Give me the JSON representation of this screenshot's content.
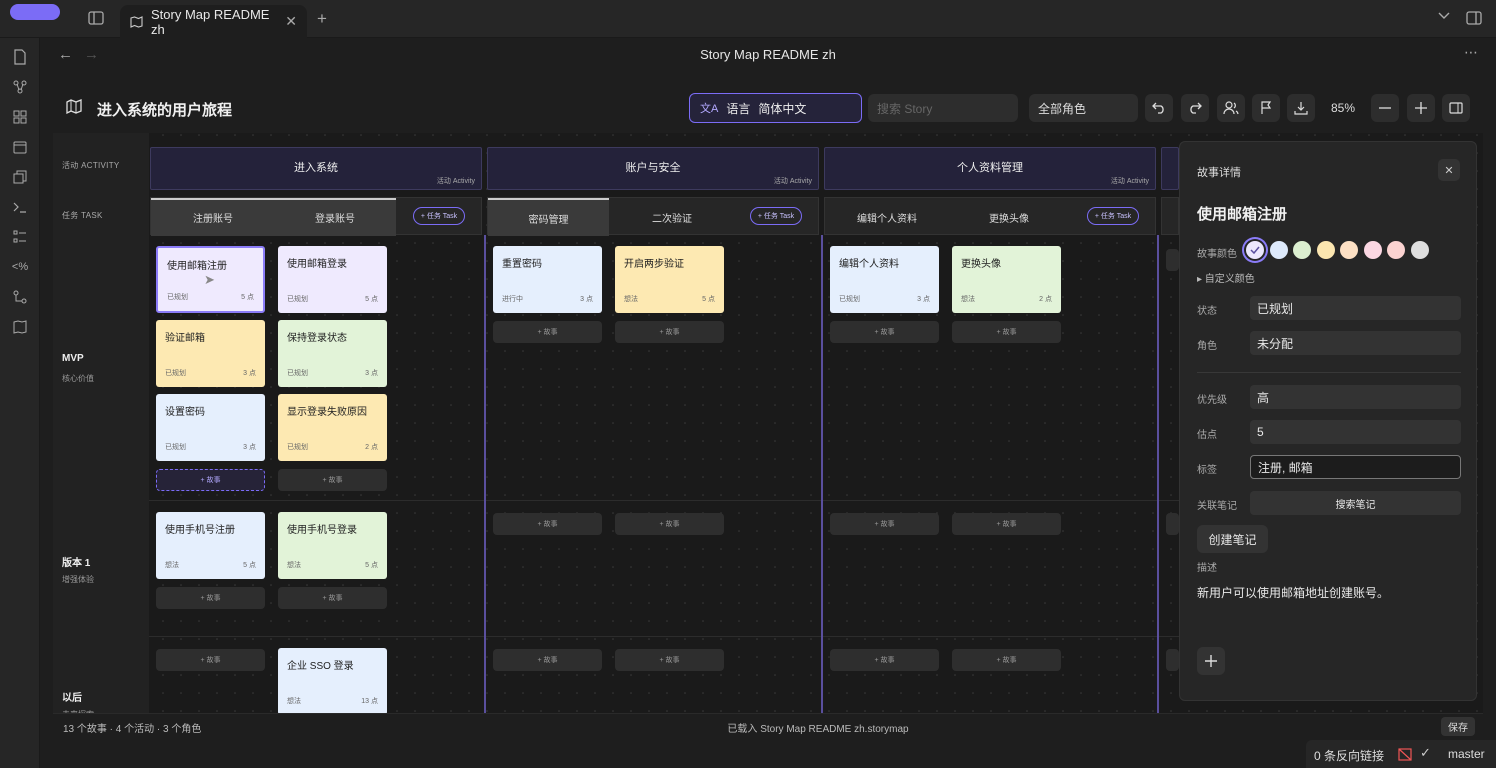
{
  "tab": {
    "title": "Story Map README zh"
  },
  "nav": {
    "title": "Story Map README zh"
  },
  "map": {
    "title": "进入系统的用户旅程"
  },
  "toolbar": {
    "lang_label": "语言",
    "lang_value": "简体中文",
    "search_placeholder": "搜索 Story",
    "roles": "全部角色",
    "zoom": "85%"
  },
  "rows": {
    "activity": "活动 ACTIVITY",
    "task": "任务 TASK"
  },
  "releases": [
    {
      "name": "MVP",
      "sub": "核心价值"
    },
    {
      "name": "版本 1",
      "sub": "增强体验"
    },
    {
      "name": "以后",
      "sub": "未来探索"
    }
  ],
  "activities": [
    {
      "title": "进入系统",
      "sub": "活动 Activity"
    },
    {
      "title": "账户与安全",
      "sub": "活动 Activity"
    },
    {
      "title": "个人资料管理",
      "sub": "活动 Activity"
    }
  ],
  "tasks": [
    "注册账号",
    "登录账号",
    "密码管理",
    "二次验证",
    "编辑个人资料",
    "更换头像"
  ],
  "add_task": "+ 任务 Task",
  "add_story": "+ 故事",
  "cards": [
    {
      "title": "使用邮箱注册",
      "status": "已规划",
      "points": "5 点",
      "color": "#efeafe"
    },
    {
      "title": "验证邮箱",
      "status": "已规划",
      "points": "3 点",
      "color": "#fde9b2"
    },
    {
      "title": "设置密码",
      "status": "已规划",
      "points": "3 点",
      "color": "#e5effd"
    },
    {
      "title": "使用邮箱登录",
      "status": "已规划",
      "points": "5 点",
      "color": "#efeafe"
    },
    {
      "title": "保持登录状态",
      "status": "已规划",
      "points": "3 点",
      "color": "#e2f3d8"
    },
    {
      "title": "显示登录失败原因",
      "status": "已规划",
      "points": "2 点",
      "color": "#fde9b2"
    },
    {
      "title": "重置密码",
      "status": "进行中",
      "points": "3 点",
      "color": "#e5effd"
    },
    {
      "title": "开启两步验证",
      "status": "想法",
      "points": "5 点",
      "color": "#fde9b2"
    },
    {
      "title": "编辑个人资料",
      "status": "已规划",
      "points": "3 点",
      "color": "#e5effd"
    },
    {
      "title": "更换头像",
      "status": "想法",
      "points": "2 点",
      "color": "#e2f3d8"
    },
    {
      "title": "使用手机号注册",
      "status": "想法",
      "points": "5 点",
      "color": "#e5effd"
    },
    {
      "title": "使用手机号登录",
      "status": "想法",
      "points": "5 点",
      "color": "#e2f3d8"
    },
    {
      "title": "企业 SSO 登录",
      "status": "想法",
      "points": "13 点",
      "color": "#e5effd"
    }
  ],
  "panel": {
    "header": "故事详情",
    "title": "使用邮箱注册",
    "color_label": "故事颜色",
    "custom_color": "▸ 自定义颜色",
    "status_label": "状态",
    "status": "已规划",
    "role_label": "角色",
    "role": "未分配",
    "priority_label": "优先级",
    "priority": "高",
    "points_label": "估点",
    "points": "5",
    "tags_label": "标签",
    "tags": "注册, 邮箱",
    "notes_label": "关联笔记",
    "notes_button": "搜索笔记",
    "create_note": "创建笔记",
    "desc_label": "描述",
    "desc": "新用户可以使用邮箱地址创建账号。",
    "swatches": [
      "#ece7fd",
      "#dde9fb",
      "#dcefd0",
      "#fbe6b0",
      "#fde0c4",
      "#fbd7e2",
      "#fbd3d1",
      "#dedede"
    ]
  },
  "status": {
    "counts": "13 个故事 · 4 个活动 · 3 个角色",
    "loaded": "已载入 Story Map README zh.storymap",
    "save": "保存"
  },
  "bottom": {
    "backlinks": "0 条反向链接",
    "branch": "master"
  }
}
